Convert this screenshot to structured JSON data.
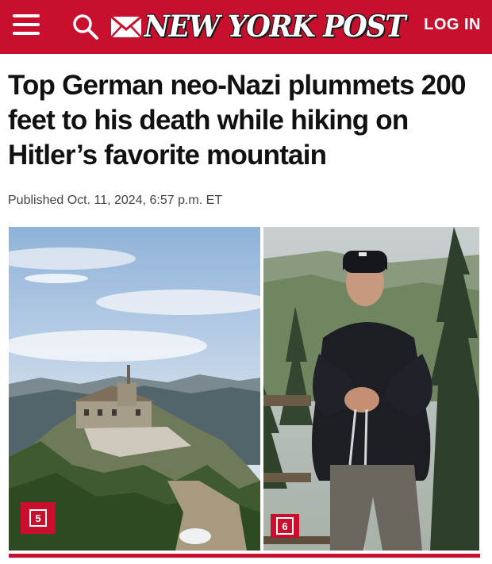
{
  "header": {
    "brand": "NEW YORK POST",
    "login_label": "LOG IN",
    "background_color": "#c8102e",
    "icons": [
      "menu-icon",
      "search-icon",
      "mail-icon"
    ]
  },
  "article": {
    "headline": "Top German neo-Nazi plummets 200 feet to his death while hiking on Hitler’s favorite mountain",
    "published": "Published Oct. 11, 2024, 6:57 p.m. ET"
  },
  "gallery": {
    "left_badge": "5",
    "right_badge": "6"
  }
}
